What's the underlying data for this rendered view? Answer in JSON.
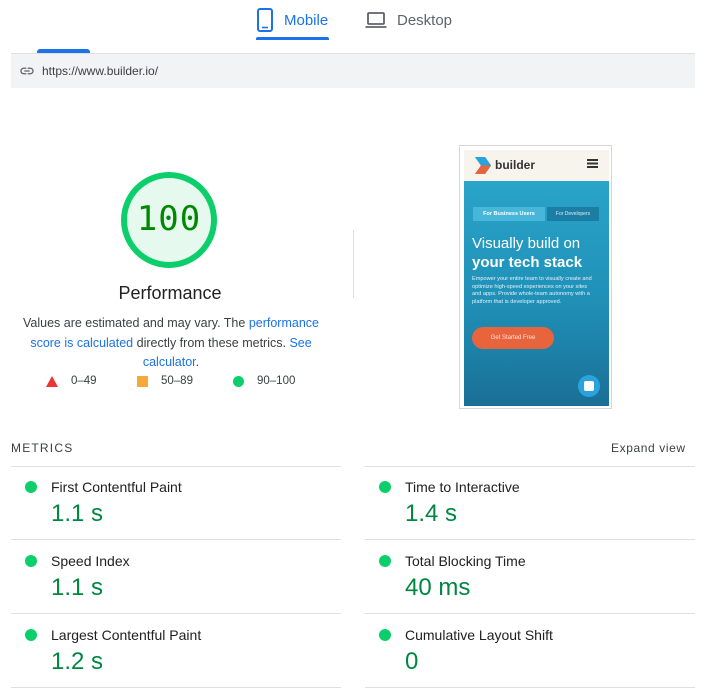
{
  "tabs": [
    {
      "label": "Mobile",
      "icon": "smartphone-icon",
      "active": true
    },
    {
      "label": "Desktop",
      "icon": "laptop-icon",
      "active": false
    }
  ],
  "url_bar": {
    "url": "https://www.builder.io/",
    "icon": "link-icon"
  },
  "score": {
    "value": "100",
    "fraction": 1.0,
    "title": "Performance",
    "description": {
      "part1": "Values are estimated and may vary. The ",
      "link1": "performance score is calculated",
      "part2": " directly from these metrics. ",
      "link2": "See calculator",
      "part3": "."
    },
    "color": "#0cce6b"
  },
  "legend": [
    {
      "range": "0–49",
      "shape": "triangle",
      "color": "#eb3434"
    },
    {
      "range": "50–89",
      "shape": "square",
      "color": "#f7a83a"
    },
    {
      "range": "90–100",
      "shape": "circle",
      "color": "#0cce6b"
    }
  ],
  "screenshot": {
    "brand": "builder",
    "tab_business": "For Business Users",
    "tab_developers": "For Developers",
    "headline_line1": "Visually build on",
    "headline_line2": "your tech stack",
    "paragraph": "Empower your entire team to visually create and optimize high-speed experiences on your sites and apps. Provide whole-team autonomy with a platform that is developer approved.",
    "cta": "Get Started Free"
  },
  "metrics": {
    "heading": "METRICS",
    "expand_label": "Expand view",
    "items": [
      {
        "label": "First Contentful Paint",
        "value": "1.1 s"
      },
      {
        "label": "Time to Interactive",
        "value": "1.4 s"
      },
      {
        "label": "Speed Index",
        "value": "1.1 s"
      },
      {
        "label": "Total Blocking Time",
        "value": "40 ms"
      },
      {
        "label": "Largest Contentful Paint",
        "value": "1.2 s"
      },
      {
        "label": "Cumulative Layout Shift",
        "value": "0"
      }
    ]
  },
  "colors": {
    "accent": "#1a73e8",
    "pass": "#0cce6b",
    "pass_text": "#018642"
  }
}
